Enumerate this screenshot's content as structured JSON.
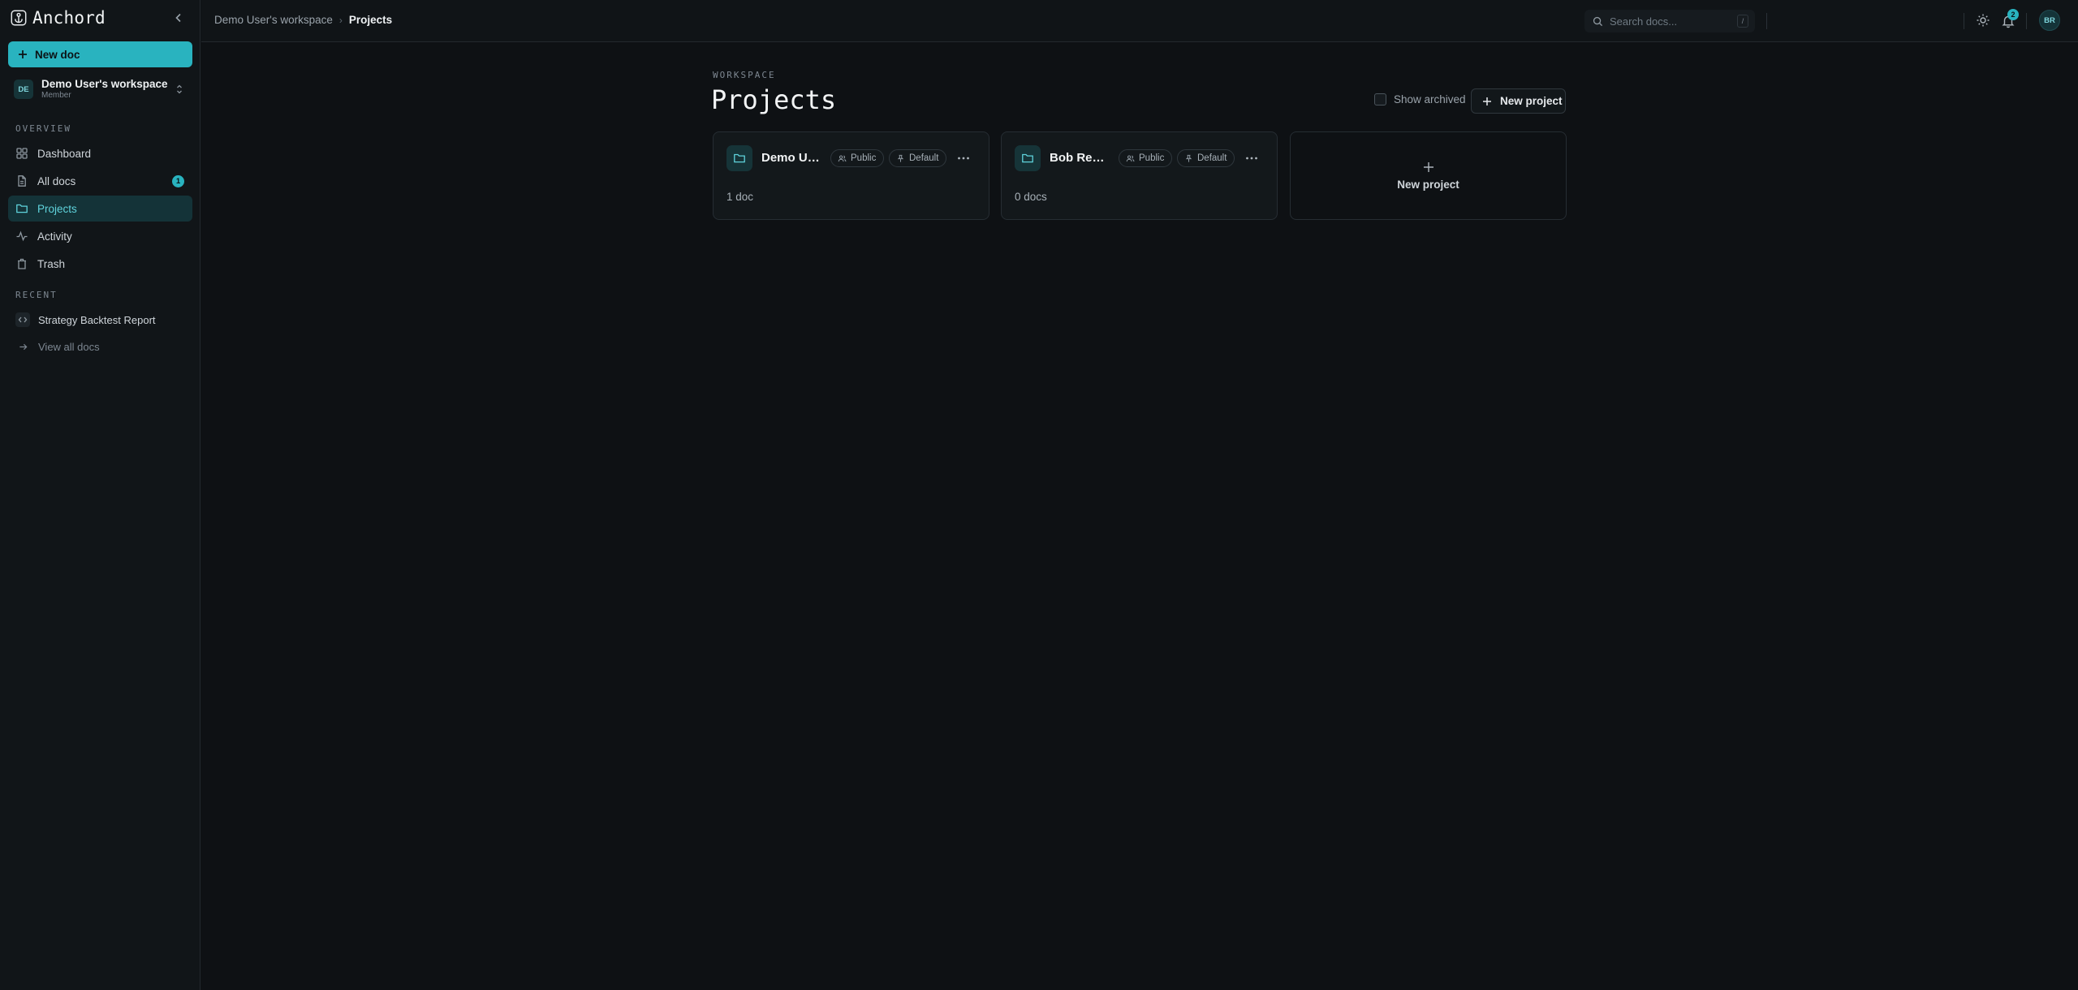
{
  "app": {
    "name": "Anchord"
  },
  "sidebar": {
    "new_doc_label": "New doc",
    "workspace": {
      "initials": "DE",
      "name": "Demo User's workspace",
      "role": "Member"
    },
    "overview_label": "OVERVIEW",
    "items": [
      {
        "label": "Dashboard",
        "icon": "grid-icon"
      },
      {
        "label": "All docs",
        "icon": "file-icon",
        "badge": "1"
      },
      {
        "label": "Projects",
        "icon": "folder-icon",
        "active": true
      },
      {
        "label": "Activity",
        "icon": "activity-icon"
      },
      {
        "label": "Trash",
        "icon": "trash-icon"
      }
    ],
    "recent_label": "RECENT",
    "recent": [
      {
        "label": "Strategy Backtest Report",
        "icon": "code-icon"
      }
    ],
    "view_all_label": "View all docs"
  },
  "topbar": {
    "breadcrumb": {
      "parent": "Demo User's workspace",
      "current": "Projects"
    },
    "search": {
      "placeholder": "Search docs...",
      "shortcut": "/"
    },
    "notifications_count": "2",
    "user_initials": "BR"
  },
  "main": {
    "eyebrow": "WORKSPACE",
    "title": "Projects",
    "show_archived_label": "Show archived",
    "new_project_label": "New project",
    "projects": [
      {
        "name": "Demo User's Project",
        "visibility": "Public",
        "tag": "Default",
        "count": "1 doc"
      },
      {
        "name": "Bob Review Project",
        "visibility": "Public",
        "tag": "Default",
        "count": "0 docs"
      }
    ],
    "new_project_card_label": "New project"
  },
  "colors": {
    "accent": "#29b3bf",
    "background": "#0e1114",
    "sidebar": "#111518",
    "active_nav": "#143338"
  }
}
